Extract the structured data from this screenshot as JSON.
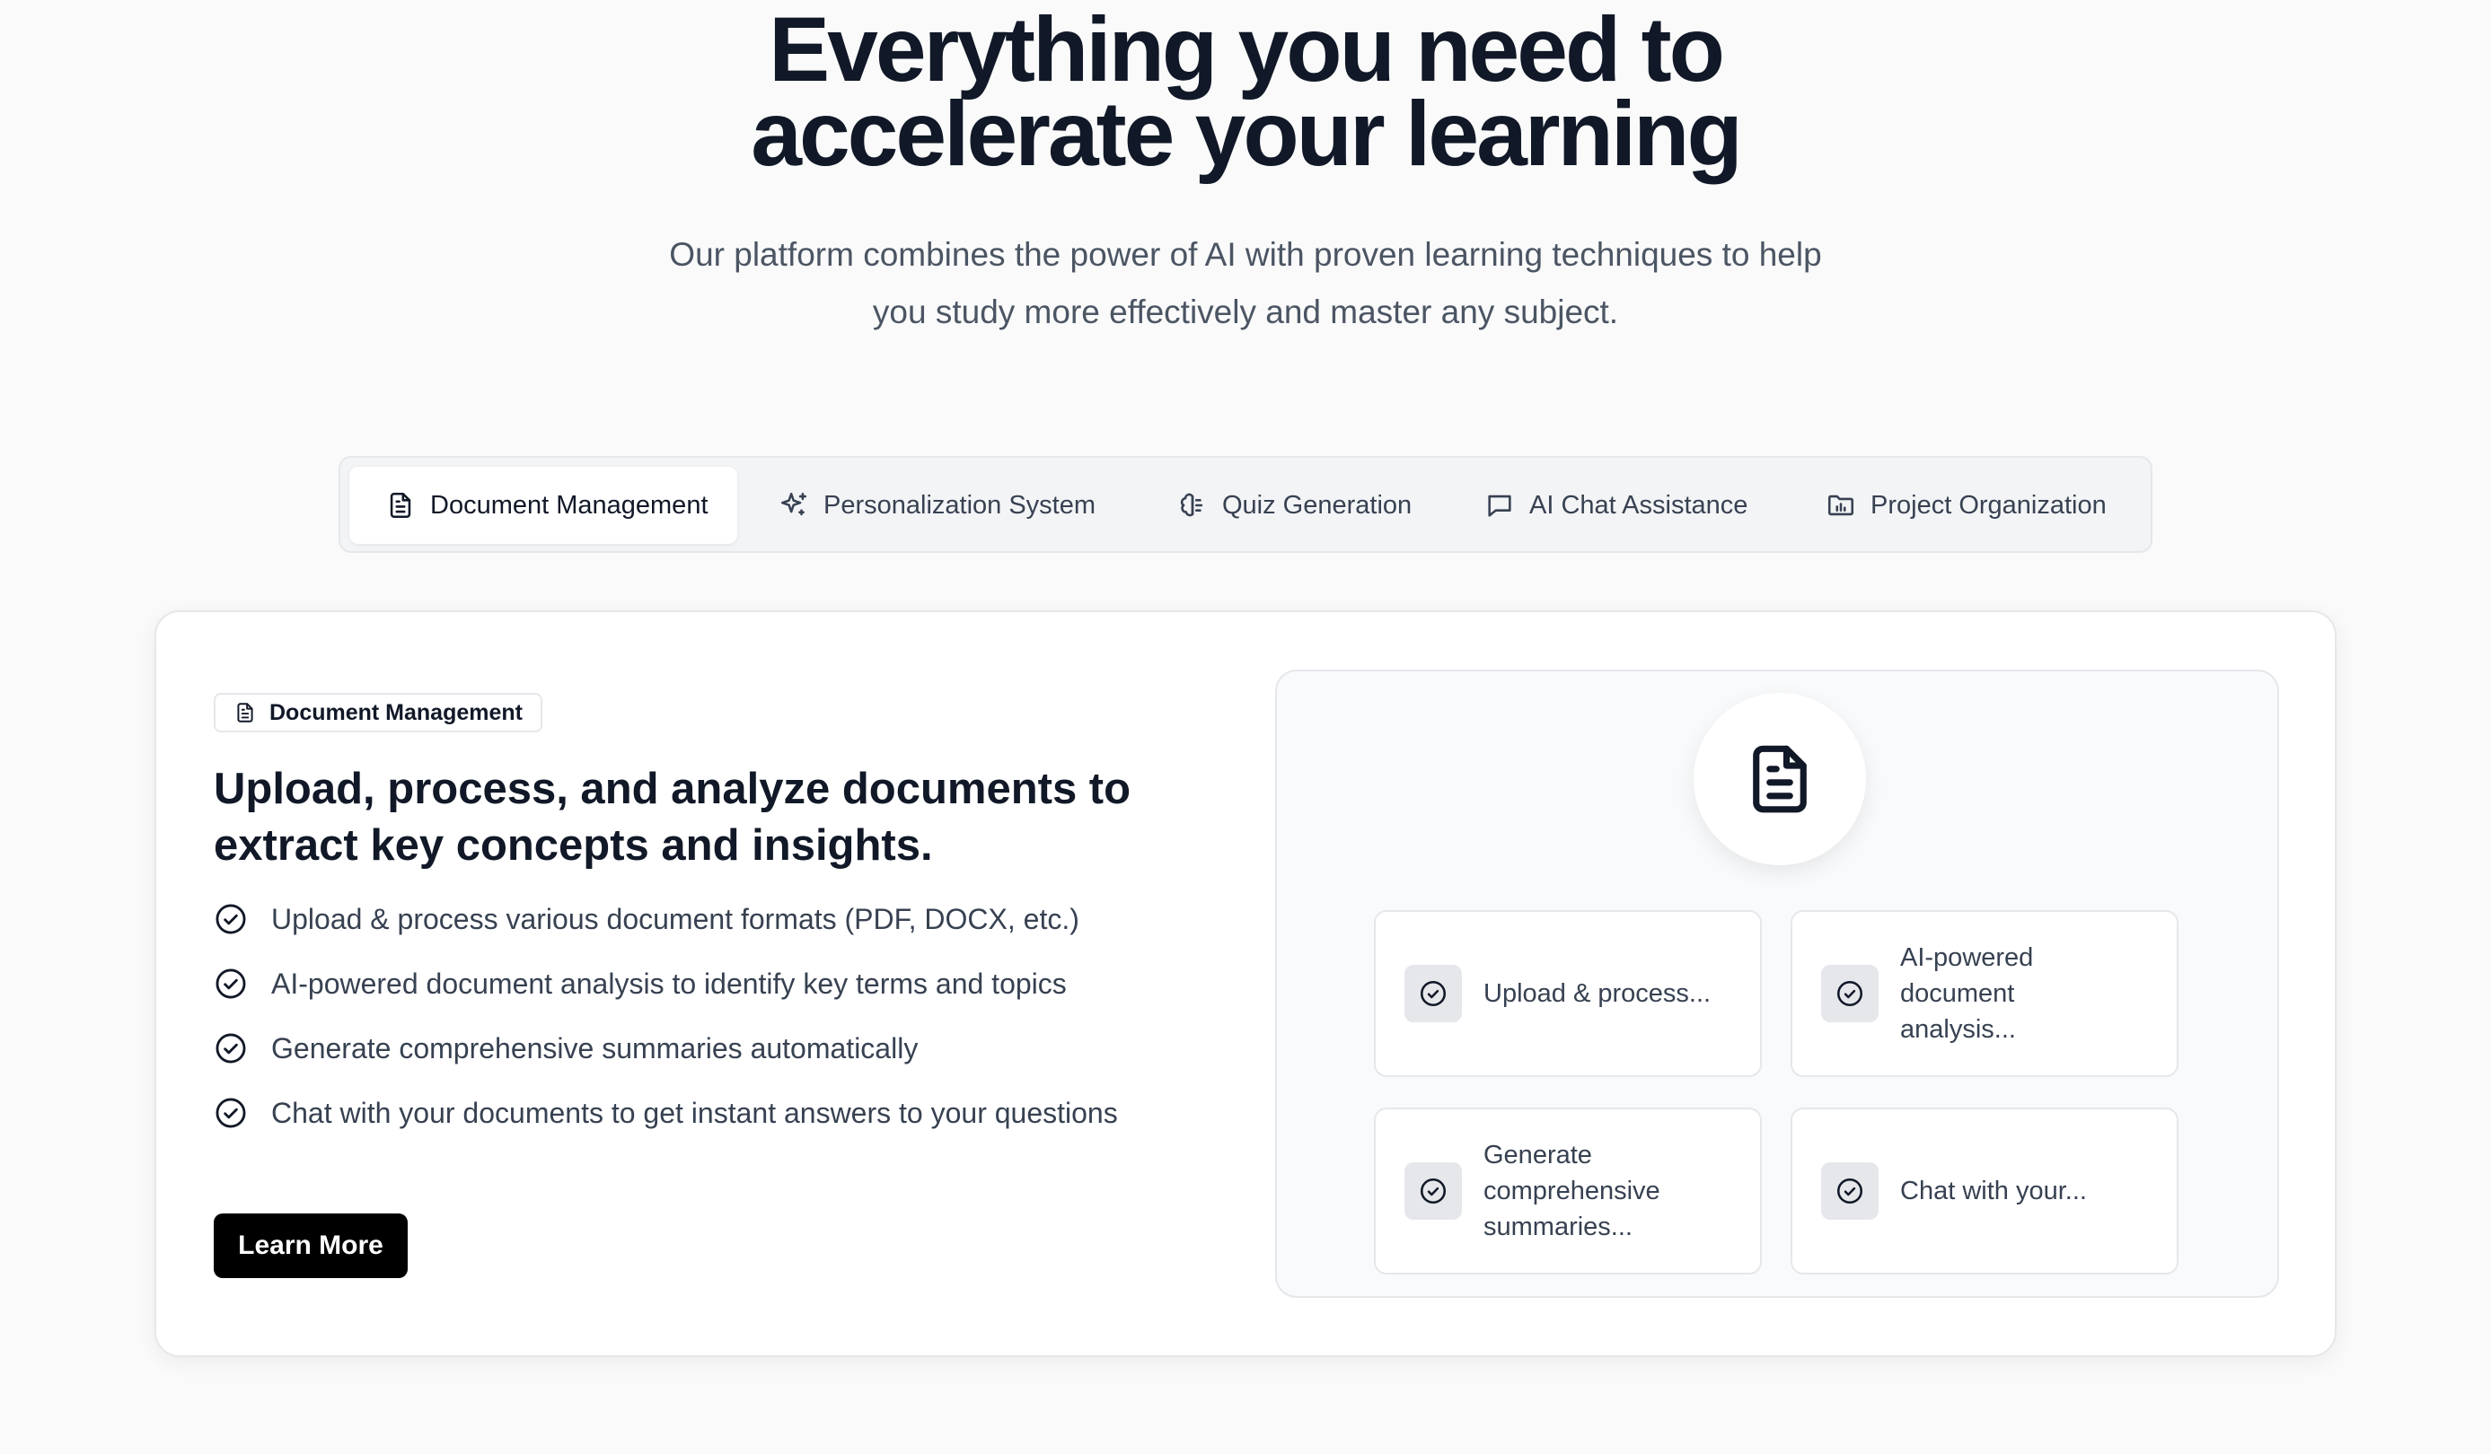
{
  "hero": {
    "title_line1": "Everything you need to",
    "title_line2": "accelerate your learning",
    "subtitle_line1": "Our platform combines the power of AI with proven learning techniques to help",
    "subtitle_line2": "you study more effectively and master any subject."
  },
  "tabs": [
    {
      "label": "Document Management",
      "icon": "document-icon",
      "active": true
    },
    {
      "label": "Personalization System",
      "icon": "sparkles-icon",
      "active": false
    },
    {
      "label": "Quiz Generation",
      "icon": "brain-icon",
      "active": false
    },
    {
      "label": "AI Chat Assistance",
      "icon": "chat-icon",
      "active": false
    },
    {
      "label": "Project Organization",
      "icon": "folder-chart-icon",
      "active": false
    }
  ],
  "feature": {
    "badge": "Document Management",
    "heading_line1": "Upload, process, and analyze documents to",
    "heading_line2": "extract key concepts and insights.",
    "items": [
      "Upload & process various document formats (PDF, DOCX, etc.)",
      "AI-powered document analysis to identify key terms and topics",
      "Generate comprehensive summaries automatically",
      "Chat with your documents to get instant answers to your questions"
    ],
    "cta": "Learn More"
  },
  "panel": {
    "cards": [
      "Upload & process...",
      "AI-powered document analysis...",
      "Generate comprehensive summaries...",
      "Chat with your..."
    ]
  },
  "colors": {
    "heading": "#111827",
    "body": "#374151",
    "muted": "#4b5563",
    "border": "#e5e7eb",
    "button": "#000000"
  }
}
